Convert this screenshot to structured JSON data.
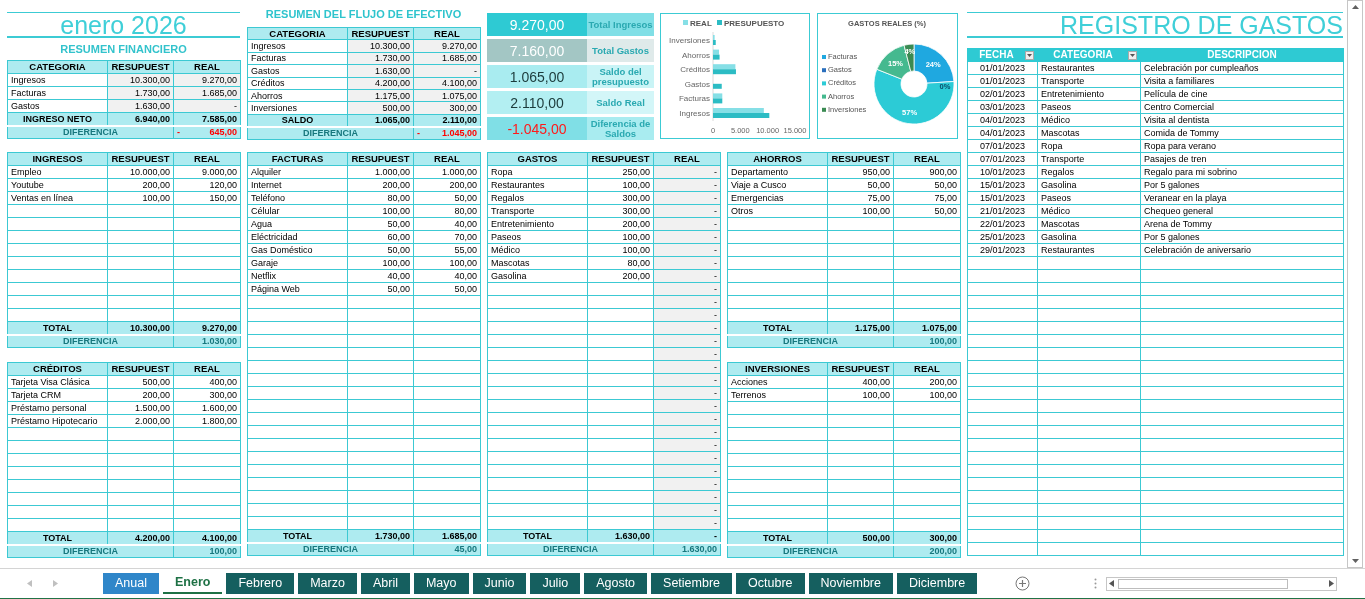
{
  "month_title": "enero 2026",
  "financial_summary": {
    "title": "RESUMEN FINANCIERO",
    "columns": [
      "CATEGORIA",
      "RESUPUEST",
      "REAL"
    ],
    "rows": [
      {
        "name": "Ingresos",
        "budget": "10.300,00",
        "real": "9.270,00"
      },
      {
        "name": "Facturas",
        "budget": "1.730,00",
        "real": "1.685,00"
      },
      {
        "name": "Gastos",
        "budget": "1.630,00",
        "real": "-"
      }
    ],
    "total": {
      "label": "INGRESO NETO",
      "budget": "6.940,00",
      "real": "7.585,00"
    },
    "difference": {
      "label": "DIFERENCIA",
      "sign": "-",
      "value": "645,00",
      "negative": true
    }
  },
  "cash_flow": {
    "title": "RESUMEN DEL FLUJO DE EFECTIVO",
    "columns": [
      "CATEGORIA",
      "RESUPUEST",
      "REAL"
    ],
    "rows": [
      {
        "name": "Ingresos",
        "budget": "10.300,00",
        "real": "9.270,00"
      },
      {
        "name": "Facturas",
        "budget": "1.730,00",
        "real": "1.685,00"
      },
      {
        "name": "Gastos",
        "budget": "1.630,00",
        "real": "-"
      },
      {
        "name": "Créditos",
        "budget": "4.200,00",
        "real": "4.100,00"
      },
      {
        "name": "Ahorros",
        "budget": "1.175,00",
        "real": "1.075,00"
      },
      {
        "name": "Inversiones",
        "budget": "500,00",
        "real": "300,00"
      }
    ],
    "total": {
      "label": "SALDO",
      "budget": "1.065,00",
      "real": "2.110,00"
    },
    "difference": {
      "label": "DIFERENCIA",
      "sign": "-",
      "value": "1.045,00",
      "negative": true
    }
  },
  "kpis": [
    {
      "kind": "income",
      "value": "9.270,00",
      "label": "Total Ingresos"
    },
    {
      "kind": "expense",
      "value": "7.160,00",
      "label": "Total Gastos"
    },
    {
      "kind": "budget",
      "value": "1.065,00",
      "label": "Saldo del presupuesto"
    },
    {
      "kind": "balance",
      "value": "2.110,00",
      "label": "Saldo Real"
    },
    {
      "kind": "difference",
      "value": "-1.045,00",
      "label": "Diferencia de Saldos"
    }
  ],
  "bar_chart": {
    "chart_data": {
      "type": "bar",
      "orientation": "horizontal",
      "legend": true,
      "categories": [
        "Inversiones",
        "Ahorros",
        "Créditos",
        "Gastos",
        "Facturas",
        "Ingresos"
      ],
      "series": [
        {
          "name": "REAL",
          "color": "#86dfe6",
          "values": [
            300,
            1100,
            4100,
            0,
            1700,
            9300
          ]
        },
        {
          "name": "PRESUPUESTO",
          "color": "#2cbcc4",
          "values": [
            500,
            1200,
            4200,
            1600,
            1700,
            10300
          ]
        }
      ],
      "xlim": [
        0,
        15000
      ],
      "xticks": [
        0,
        {
          "value": 5000,
          "label": "5.000"
        },
        {
          "value": 10000,
          "label": "10.000"
        },
        {
          "value": 15000,
          "label": "15.000"
        }
      ]
    }
  },
  "pie_chart": {
    "chart_data": {
      "type": "donut",
      "title": "GASTOS REALES (%)",
      "legend": true,
      "categories": [
        "Facturas",
        "Gastos",
        "Créditos",
        "Ahorros",
        "Inversiones"
      ],
      "values": [
        24,
        0,
        57,
        15,
        4
      ],
      "colors": [
        "#1fa8e0",
        "#2a6fbd",
        "#2ccbd6",
        "#45b98f",
        "#3a8a52"
      ],
      "value_labels": [
        "24%",
        "0%",
        "57%",
        "15%",
        "4%"
      ]
    }
  },
  "tables": [
    {
      "columns": [
        "INGRESOS",
        "RESUPUEST",
        "REAL"
      ],
      "shaded": false,
      "rows": [
        {
          "name": "Empleo",
          "budget": "10.000,00",
          "real": "9.000,00"
        },
        {
          "name": "Youtube",
          "budget": "200,00",
          "real": "120,00"
        },
        {
          "name": "Ventas en línea",
          "budget": "100,00",
          "real": "150,00"
        }
      ],
      "total": {
        "label": "TOTAL",
        "budget": "10.300,00",
        "real": "9.270,00"
      },
      "difference": {
        "label": "DIFERENCIA",
        "value": "1.030,00",
        "negative": false
      }
    },
    {
      "columns": [
        "CRÉDITOS",
        "RESUPUEST",
        "REAL"
      ],
      "shaded": false,
      "rows": [
        {
          "name": "Tarjeta Visa Clásica",
          "budget": "500,00",
          "real": "400,00"
        },
        {
          "name": "Tarjeta CRM",
          "budget": "200,00",
          "real": "300,00"
        },
        {
          "name": "Préstamo personal",
          "budget": "1.500,00",
          "real": "1.600,00"
        },
        {
          "name": "Préstamo Hipotecario",
          "budget": "2.000,00",
          "real": "1.800,00"
        }
      ],
      "total": {
        "label": "TOTAL",
        "budget": "4.200,00",
        "real": "4.100,00"
      },
      "difference": {
        "label": "DIFERENCIA",
        "value": "100,00",
        "negative": false
      }
    },
    {
      "columns": [
        "FACTURAS",
        "RESUPUEST",
        "REAL"
      ],
      "shaded": false,
      "rows": [
        {
          "name": "Alquiler",
          "budget": "1.000,00",
          "real": "1.000,00"
        },
        {
          "name": "Internet",
          "budget": "200,00",
          "real": "200,00"
        },
        {
          "name": "Teléfono",
          "budget": "80,00",
          "real": "50,00"
        },
        {
          "name": "Célular",
          "budget": "100,00",
          "real": "80,00"
        },
        {
          "name": "Agua",
          "budget": "50,00",
          "real": "40,00"
        },
        {
          "name": "Eléctricidad",
          "budget": "60,00",
          "real": "70,00"
        },
        {
          "name": "Gas Doméstico",
          "budget": "50,00",
          "real": "55,00"
        },
        {
          "name": "Garaje",
          "budget": "100,00",
          "real": "100,00"
        },
        {
          "name": "Netflix",
          "budget": "40,00",
          "real": "40,00"
        },
        {
          "name": "Página Web",
          "budget": "50,00",
          "real": "50,00"
        }
      ],
      "total": {
        "label": "TOTAL",
        "budget": "1.730,00",
        "real": "1.685,00"
      },
      "difference": {
        "label": "DIFERENCIA",
        "value": "45,00",
        "negative": false
      }
    },
    {
      "columns": [
        "GASTOS",
        "RESUPUEST",
        "REAL"
      ],
      "shaded": true,
      "rows": [
        {
          "name": "Ropa",
          "budget": "250,00",
          "real": "-"
        },
        {
          "name": "Restaurantes",
          "budget": "100,00",
          "real": "-"
        },
        {
          "name": "Regalos",
          "budget": "300,00",
          "real": "-"
        },
        {
          "name": "Transporte",
          "budget": "300,00",
          "real": "-"
        },
        {
          "name": "Entretenimiento",
          "budget": "200,00",
          "real": "-"
        },
        {
          "name": "Paseos",
          "budget": "100,00",
          "real": "-"
        },
        {
          "name": "Médico",
          "budget": "100,00",
          "real": "-"
        },
        {
          "name": "Mascotas",
          "budget": "80,00",
          "real": "-"
        },
        {
          "name": "Gasolina",
          "budget": "200,00",
          "real": "-"
        },
        {
          "real": "-"
        },
        {
          "real": "-"
        },
        {
          "real": "-"
        },
        {
          "real": "-"
        },
        {
          "real": "-"
        },
        {
          "real": "-"
        },
        {
          "real": "-"
        },
        {
          "real": "-"
        },
        {
          "real": "-"
        },
        {
          "real": "-"
        },
        {
          "real": "-"
        },
        {
          "real": "-"
        },
        {
          "real": "-"
        },
        {
          "real": "-"
        },
        {
          "real": "-"
        },
        {
          "real": "-"
        },
        {
          "real": "-"
        },
        {
          "real": "-"
        },
        {
          "real": "-"
        }
      ],
      "total": {
        "label": "TOTAL",
        "budget": "1.630,00",
        "real": "-"
      },
      "difference": {
        "label": "DIFERENCIA",
        "value": "1.630,00",
        "negative": false
      }
    },
    {
      "columns": [
        "AHORROS",
        "RESUPUEST",
        "REAL"
      ],
      "shaded": false,
      "rows": [
        {
          "name": "Departamento",
          "budget": "950,00",
          "real": "900,00"
        },
        {
          "name": "Viaje a Cusco",
          "budget": "50,00",
          "real": "50,00"
        },
        {
          "name": "Emergencias",
          "budget": "75,00",
          "real": "75,00"
        },
        {
          "name": "Otros",
          "budget": "100,00",
          "real": "50,00"
        }
      ],
      "total": {
        "label": "TOTAL",
        "budget": "1.175,00",
        "real": "1.075,00"
      },
      "difference": {
        "label": "DIFERENCIA",
        "value": "100,00",
        "negative": false
      }
    },
    {
      "columns": [
        "INVERSIONES",
        "RESUPUEST",
        "REAL"
      ],
      "shaded": false,
      "rows": [
        {
          "name": "Acciones",
          "budget": "400,00",
          "real": "200,00"
        },
        {
          "name": "Terrenos",
          "budget": "100,00",
          "real": "100,00"
        }
      ],
      "total": {
        "label": "TOTAL",
        "budget": "500,00",
        "real": "300,00"
      },
      "difference": {
        "label": "DIFERENCIA",
        "value": "200,00",
        "negative": false
      }
    }
  ],
  "register": {
    "title": "REGISTRO DE GASTOS",
    "columns": [
      {
        "label": "FECHA",
        "filter": true
      },
      {
        "label": "CATEGORIA",
        "filter": true
      },
      {
        "label": "DESCRIPCION",
        "filter": false
      }
    ],
    "rows": [
      {
        "date": "01/01/2023",
        "category": "Restaurantes",
        "description": "Celebración por cumpleaños"
      },
      {
        "date": "01/01/2023",
        "category": "Transporte",
        "description": "Visita a familiares"
      },
      {
        "date": "02/01/2023",
        "category": "Entretenimiento",
        "description": "Película de cine"
      },
      {
        "date": "03/01/2023",
        "category": "Paseos",
        "description": "Centro Comercial"
      },
      {
        "date": "04/01/2023",
        "category": "Médico",
        "description": "Visita al dentista"
      },
      {
        "date": "04/01/2023",
        "category": "Mascotas",
        "description": "Comida de Tommy"
      },
      {
        "date": "07/01/2023",
        "category": "Ropa",
        "description": "Ropa para verano"
      },
      {
        "date": "07/01/2023",
        "category": "Transporte",
        "description": "Pasajes de tren"
      },
      {
        "date": "10/01/2023",
        "category": "Regalos",
        "description": "Regalo para mi sobrino"
      },
      {
        "date": "15/01/2023",
        "category": "Gasolina",
        "description": "Por 5 galones"
      },
      {
        "date": "15/01/2023",
        "category": "Paseos",
        "description": "Veranear en la playa"
      },
      {
        "date": "21/01/2023",
        "category": "Médico",
        "description": "Chequeo general"
      },
      {
        "date": "22/01/2023",
        "category": "Mascotas",
        "description": "Arena de Tommy"
      },
      {
        "date": "25/01/2023",
        "category": "Gasolina",
        "description": "Por 5 galones"
      },
      {
        "date": "29/01/2023",
        "category": "Restaurantes",
        "description": "Celebración de aniversario"
      }
    ]
  },
  "sheet_tabs": [
    {
      "label": "Anual",
      "selected": false,
      "color": "#2f86c9"
    },
    {
      "label": "Enero",
      "selected": true,
      "color": "#1e7145"
    },
    {
      "label": "Febrero",
      "selected": false,
      "color": "#155f5f"
    },
    {
      "label": "Marzo",
      "selected": false,
      "color": "#155f5f"
    },
    {
      "label": "Abril",
      "selected": false,
      "color": "#155f5f"
    },
    {
      "label": "Mayo",
      "selected": false,
      "color": "#155f5f"
    },
    {
      "label": "Junio",
      "selected": false,
      "color": "#155f5f"
    },
    {
      "label": "Julio",
      "selected": false,
      "color": "#155f5f"
    },
    {
      "label": "Agosto",
      "selected": false,
      "color": "#155f5f"
    },
    {
      "label": "Setiembre",
      "selected": false,
      "color": "#155f5f"
    },
    {
      "label": "Octubre",
      "selected": false,
      "color": "#155f5f"
    },
    {
      "label": "Noviembre",
      "selected": false,
      "color": "#155f5f"
    },
    {
      "label": "Diciembre",
      "selected": false,
      "color": "#155f5f"
    }
  ]
}
